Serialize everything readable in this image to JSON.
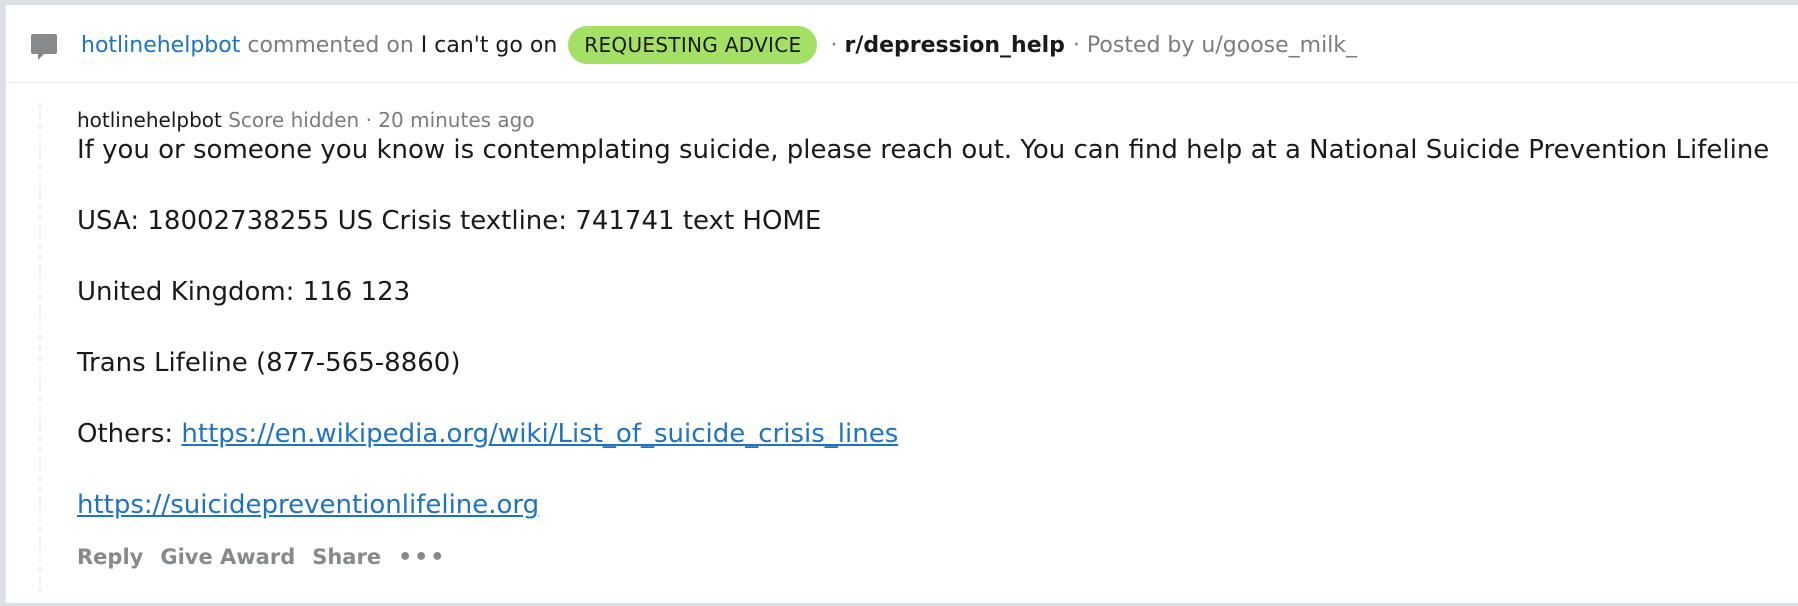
{
  "header": {
    "commenter": "hotlinehelpbot",
    "commented_on": "commented on",
    "post_title": "I can't go on",
    "flair": "REQUESTING ADVICE",
    "separator": "·",
    "subreddit": "r/depression_help",
    "posted_by": "· Posted by u/goose_milk_"
  },
  "comment": {
    "author": "hotlinehelpbot",
    "score": "Score hidden",
    "time": "· 20 minutes ago",
    "paragraphs": {
      "p1": "If you or someone you know is contemplating suicide, please reach out. You can find help at a National Suicide Prevention Lifeline",
      "p2": "USA: 18002738255 US Crisis textline: 741741 text HOME",
      "p3": "United Kingdom: 116 123",
      "p4": "Trans Lifeline (877-565-8860)",
      "p5_prefix": "Others:",
      "p5_link": "https://en.wikipedia.org/wiki/List_of_suicide_crisis_lines",
      "p6_link": "https://suicidepreventionlifeline.org"
    }
  },
  "actions": {
    "reply": "Reply",
    "give_award": "Give Award",
    "share": "Share",
    "more": "•••"
  },
  "icons": {
    "comment": "comment-bubble-icon"
  },
  "colors": {
    "link": "#1f73c1",
    "flair_bg": "#a3e065",
    "muted": "#7c7c7c"
  }
}
